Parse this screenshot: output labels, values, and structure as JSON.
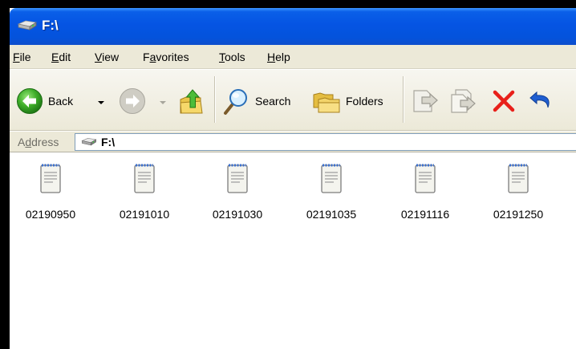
{
  "window": {
    "title": "F:\\",
    "title_icon": "drive-icon",
    "titlebar_color": "#0554e3"
  },
  "menu": [
    {
      "label": "File",
      "ul": "F",
      "rest": "ile"
    },
    {
      "label": "Edit",
      "ul": "E",
      "rest": "dit"
    },
    {
      "label": "View",
      "ul": "V",
      "rest": "iew"
    },
    {
      "label": "Favorites",
      "pre": "F",
      "ul": "a",
      "rest": "vorites"
    },
    {
      "label": "Tools",
      "ul": "T",
      "rest": "ools"
    },
    {
      "label": "Help",
      "ul": "H",
      "rest": "elp"
    }
  ],
  "toolbar": {
    "back_label": "Back",
    "search_label": "Search",
    "folders_label": "Folders",
    "icons": [
      "back-icon",
      "forward-icon",
      "up-folder-icon",
      "search-icon",
      "folders-icon",
      "move-to-icon",
      "copy-to-icon",
      "delete-icon",
      "undo-icon"
    ]
  },
  "address": {
    "label": "Address",
    "label_ul": "d",
    "value": "F:\\",
    "icon": "drive-icon"
  },
  "files": [
    {
      "name": "02190950",
      "icon": "text-file-icon"
    },
    {
      "name": "02191010",
      "icon": "text-file-icon"
    },
    {
      "name": "02191030",
      "icon": "text-file-icon"
    },
    {
      "name": "02191035",
      "icon": "text-file-icon"
    },
    {
      "name": "02191116",
      "icon": "text-file-icon"
    },
    {
      "name": "02191250",
      "icon": "text-file-icon"
    }
  ]
}
